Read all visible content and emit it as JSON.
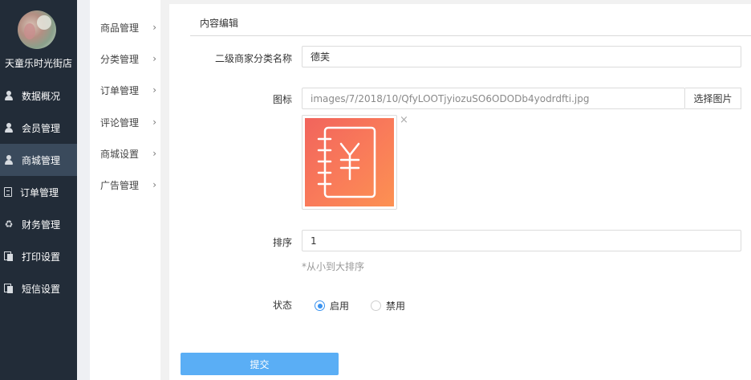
{
  "sidebar": {
    "shop_name": "天童乐时光街店",
    "items": [
      {
        "label": "数据概况",
        "icon": "user-icon"
      },
      {
        "label": "会员管理",
        "icon": "user-icon"
      },
      {
        "label": "商城管理",
        "icon": "user-icon",
        "active": true
      },
      {
        "label": "订单管理",
        "icon": "document-icon"
      },
      {
        "label": "财务管理",
        "icon": "recycle-icon"
      },
      {
        "label": "打印设置",
        "icon": "copy-icon"
      },
      {
        "label": "短信设置",
        "icon": "copy-icon"
      }
    ]
  },
  "submenu": {
    "items": [
      {
        "label": "商品管理"
      },
      {
        "label": "分类管理"
      },
      {
        "label": "订单管理"
      },
      {
        "label": "评论管理"
      },
      {
        "label": "商城设置"
      },
      {
        "label": "广告管理"
      }
    ],
    "chevron": "›"
  },
  "panel": {
    "tab_title": "内容编辑",
    "fields": {
      "name_label": "二级商家分类名称",
      "name_value": "德芙",
      "icon_label": "图标",
      "icon_path": "images/7/2018/10/QfyLOOTjyiozuSO6ODODb4yodrdfti.jpg",
      "choose_image": "选择图片",
      "remove_symbol": "×",
      "sort_label": "排序",
      "sort_value": "1",
      "sort_hint": "*从小到大排序",
      "status_label": "状态",
      "status_enabled": "启用",
      "status_disabled": "禁用"
    },
    "submit_label": "提交"
  },
  "colors": {
    "sidebar_bg": "#222c38",
    "sidebar_active": "#3a4a5c",
    "accent_blue": "#3a93f0",
    "submit_bg": "#5aaef5",
    "thumb_gradient_start": "#f1645c",
    "thumb_gradient_end": "#fc9152"
  }
}
